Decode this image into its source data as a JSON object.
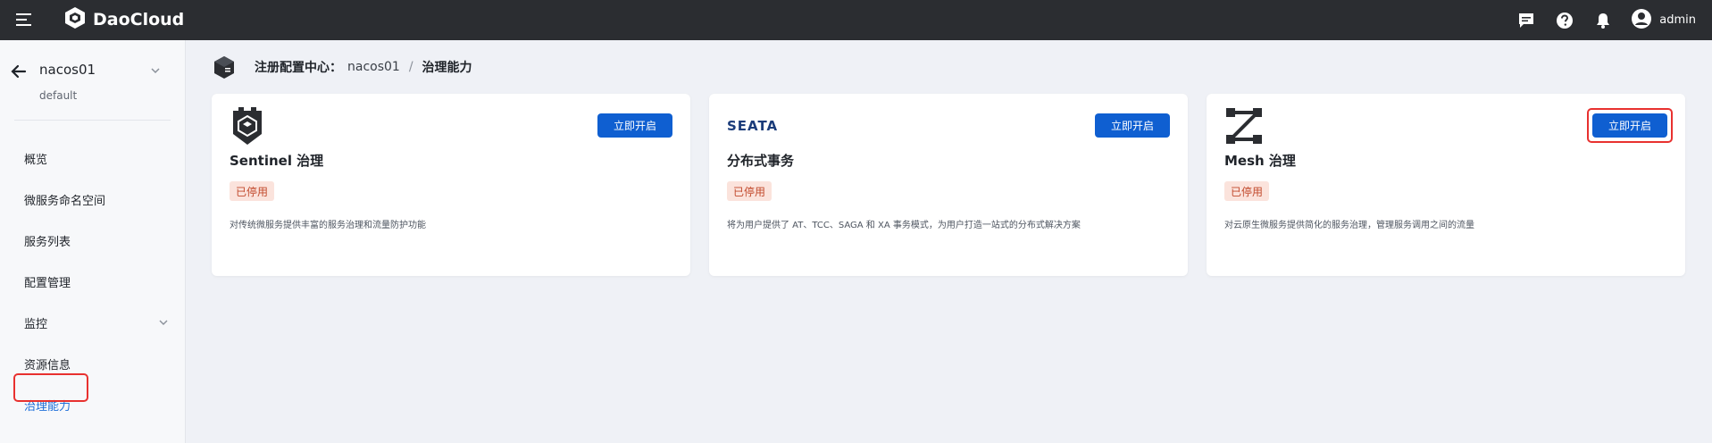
{
  "topbar": {
    "brand": "DaoCloud",
    "user_name": "admin",
    "icons": [
      "message-icon",
      "help-icon",
      "bell-icon",
      "user-avatar-icon"
    ]
  },
  "sidebar": {
    "namespace_name": "nacos01",
    "namespace_sub": "default",
    "items": [
      {
        "label": "概览"
      },
      {
        "label": "微服务命名空间"
      },
      {
        "label": "服务列表"
      },
      {
        "label": "配置管理"
      },
      {
        "label": "监控"
      },
      {
        "label": "资源信息"
      },
      {
        "label": "治理能力"
      }
    ],
    "active_color": "#1e6fd9"
  },
  "breadcrumb": {
    "root": "注册配置中心：",
    "namespace": "nacos01",
    "separator": "/",
    "current": "治理能力"
  },
  "cards": [
    {
      "title": "Sentinel 治理",
      "status": "已停用",
      "description": "对传统微服务提供丰富的服务治理和流量防护功能",
      "button_label": "立即开启",
      "logo": "sentinel-logo-icon"
    },
    {
      "title": "分布式事务",
      "status": "已停用",
      "description": "将为用户提供了 AT、TCC、SAGA 和 XA 事务模式，为用户打造一站式的分布式解决方案",
      "button_label": "立即开启",
      "logo": "seata-logo-icon",
      "logo_text": "SEATA"
    },
    {
      "title": "Mesh 治理",
      "status": "已停用",
      "description": "对云原生微服务提供简化的服务治理，管理服务调用之间的流量",
      "button_label": "立即开启",
      "logo": "mesh-logo-icon"
    }
  ],
  "colors": {
    "primary": "#0f5fd1",
    "topbar": "#2b2d31",
    "badge_bg": "#fbe3dc",
    "badge_text": "#c24a2d",
    "highlight": "#e8312f"
  }
}
